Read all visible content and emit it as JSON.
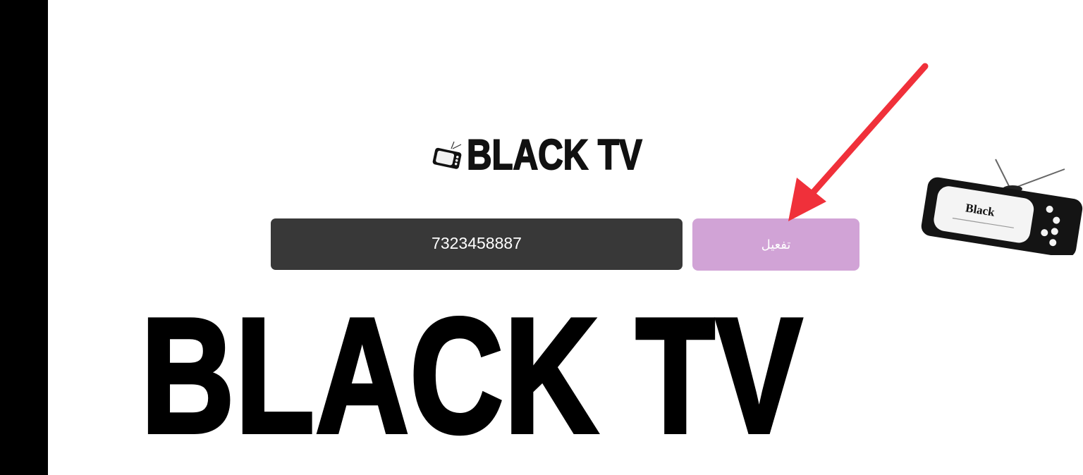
{
  "header": {
    "logo_text": "BLACK TV",
    "logo_icon": "tv-icon"
  },
  "activation": {
    "code_value": "7323458887",
    "activate_label": "تفعيل"
  },
  "annotation": {
    "arrow_icon": "red-arrow-icon",
    "arrow_color": "#f0303a"
  },
  "illustration": {
    "tv_label": "Black",
    "icon": "retro-tv-icon"
  },
  "banner": {
    "logo_text": "BLACK TV"
  },
  "colors": {
    "input_bg": "#383838",
    "button_bg": "#d1a3d6",
    "left_bar": "#000000"
  }
}
